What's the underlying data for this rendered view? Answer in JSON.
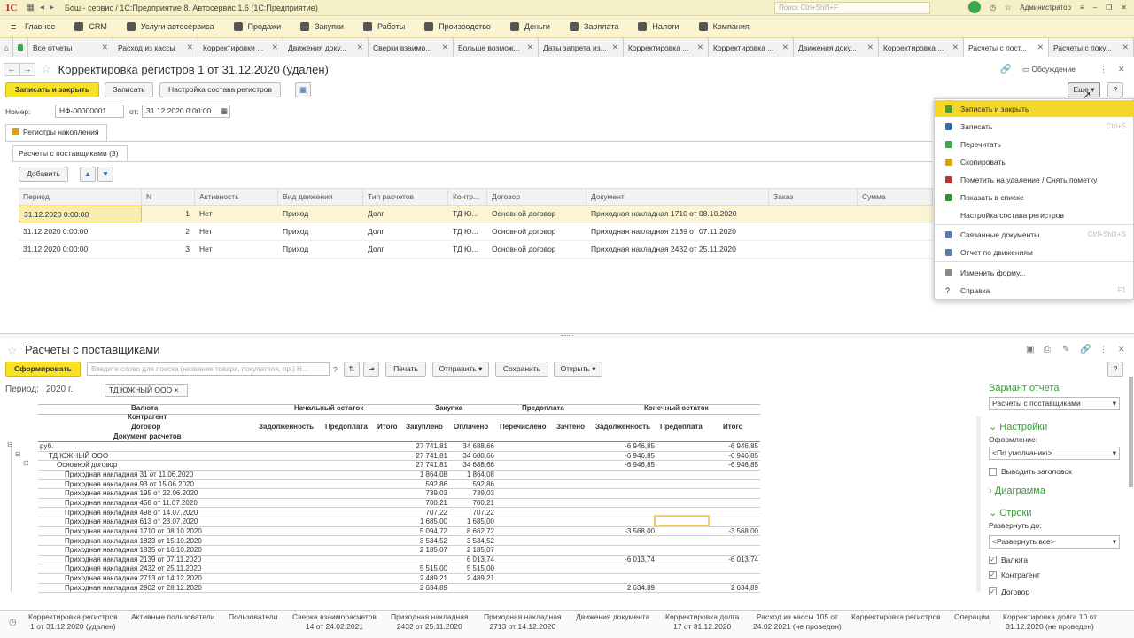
{
  "titlebar": {
    "logo": "1С",
    "title": "Бош - сервис / 1С:Предприятие 8. Автосервис 1.6  (1С:Предприятие)",
    "search_placeholder": "Поиск Ctrl+Shift+F",
    "user": "Администратор"
  },
  "menu": [
    {
      "label": "Главное"
    },
    {
      "label": "CRM"
    },
    {
      "label": "Услуги автосервиса"
    },
    {
      "label": "Продажи"
    },
    {
      "label": "Закупки"
    },
    {
      "label": "Работы"
    },
    {
      "label": "Производство"
    },
    {
      "label": "Деньги"
    },
    {
      "label": "Зарплата"
    },
    {
      "label": "Налоги"
    },
    {
      "label": "Компания"
    }
  ],
  "tabs": [
    {
      "label": "Все отчеты"
    },
    {
      "label": "Расход из кассы"
    },
    {
      "label": "Корректировки ..."
    },
    {
      "label": "Движения доку..."
    },
    {
      "label": "Сверки взаимо..."
    },
    {
      "label": "Больше возмож..."
    },
    {
      "label": "Даты запрета из..."
    },
    {
      "label": "Корректировка ..."
    },
    {
      "label": "Корректировка ..."
    },
    {
      "label": "Движения доку..."
    },
    {
      "label": "Корректировка ..."
    },
    {
      "label": "Расчеты с пост..."
    },
    {
      "label": "Расчеты с поку..."
    }
  ],
  "form": {
    "title": "Корректировка регистров 1 от 31.12.2020 (удален)",
    "discussion": "Обсуждение",
    "btn_save_close": "Записать и закрыть",
    "btn_save": "Записать",
    "btn_registers": "Настройка состава регистров",
    "btn_more": "Еще",
    "help": "?",
    "number_label": "Номер:",
    "number_value": "НФ-00000001",
    "date_label": "от:",
    "date_value": "31.12.2020  0:00:00",
    "group_tab": "Регистры накопления",
    "sub_tab": "Расчеты с поставщиками (3)",
    "btn_add": "Добавить"
  },
  "reg_table": {
    "headers": [
      "Период",
      "N",
      "Активность",
      "Вид движения",
      "Тип расчетов",
      "Контр...",
      "Договор",
      "Документ",
      "Заказ",
      "Сумма"
    ],
    "rows": [
      [
        "31.12.2020 0:00:00",
        "1",
        "Нет",
        "Приход",
        "Долг",
        "ТД Ю...",
        "Основной договор",
        "Приходная накладная 1710 от 08.10.2020",
        "",
        ""
      ],
      [
        "31.12.2020 0:00:00",
        "2",
        "Нет",
        "Приход",
        "Долг",
        "ТД Ю...",
        "Основной договор",
        "Приходная накладная 2139 от 07.11.2020",
        "",
        ""
      ],
      [
        "31.12.2020 0:00:00",
        "3",
        "Нет",
        "Приход",
        "Долг",
        "ТД Ю...",
        "Основной договор",
        "Приходная накладная 2432 от 25.11.2020",
        "",
        ""
      ]
    ]
  },
  "dropdown": [
    {
      "label": "Записать и закрыть",
      "shortcut": "",
      "icon": "save-close-icon",
      "color": "#4a9a3a"
    },
    {
      "label": "Записать",
      "shortcut": "Ctrl+S",
      "icon": "disk-icon",
      "color": "#3a6ab0"
    },
    {
      "label": "Перечитать",
      "shortcut": "",
      "icon": "refresh-icon",
      "color": "#3aa84b"
    },
    {
      "label": "Скопировать",
      "shortcut": "",
      "icon": "copy-icon",
      "color": "#d9a400"
    },
    {
      "label": "Пометить на удаление / Снять пометку",
      "shortcut": "",
      "icon": "delete-mark-icon",
      "color": "#c03030"
    },
    {
      "label": "Показать в списке",
      "shortcut": "",
      "icon": "list-icon",
      "color": "#3a8a3a"
    },
    {
      "label": "Настройка состава регистров",
      "shortcut": "",
      "icon": "",
      "color": "#fff"
    },
    {
      "label": "Связанные документы",
      "shortcut": "Ctrl+Shift+S",
      "icon": "linked-docs-icon",
      "color": "#5a7ab0"
    },
    {
      "label": "Отчет по движениям",
      "shortcut": "",
      "icon": "report-icon",
      "color": "#5a7ab0"
    },
    {
      "label": "Изменить форму...",
      "shortcut": "",
      "icon": "form-icon",
      "color": "#888"
    },
    {
      "label": "Справка",
      "shortcut": "F1",
      "icon": "help-icon",
      "color": "#333"
    }
  ],
  "report": {
    "title": "Расчеты с поставщиками",
    "btn_generate": "Сформировать",
    "search_placeholder": "Введите слово для поиска (название товара, покупателя, пр.) Н...",
    "help_q": "?",
    "btn_print": "Печать",
    "btn_send": "Отправить",
    "btn_save": "Сохранить",
    "btn_open": "Открыть",
    "period_label": "Период:",
    "period_value": "2020 г.",
    "filter_chip": "ТД ЮЖНЫЙ ООО ×",
    "col_groups": [
      "Валюта",
      "Начальный остаток",
      "Закупка",
      "Предоплата",
      "Конечный остаток"
    ],
    "row_dims": [
      "Контрагент",
      "Договор",
      "Документ расчетов"
    ],
    "subcols": [
      "Задолженность",
      "Предоплата",
      "Итого",
      "Закуплено",
      "Оплачено",
      "Перечислено",
      "Зачтено",
      "Задолженность",
      "Предоплата",
      "Итого"
    ],
    "rows": [
      {
        "name": "руб.",
        "level": 0,
        "zak": "27 741,81",
        "opl": "34 688,66",
        "kz": "-6 946,85",
        "ki": "-6 946,85"
      },
      {
        "name": "ТД ЮЖНЫЙ ООО",
        "level": 1,
        "zak": "27 741,81",
        "opl": "34 688,66",
        "kz": "-6 946,85",
        "ki": "-6 946,85"
      },
      {
        "name": "Основной договор",
        "level": 2,
        "zak": "27 741,81",
        "opl": "34 688,66",
        "kz": "-6 946,85",
        "ki": "-6 946,85"
      },
      {
        "name": "Приходная накладная 31 от 11.06.2020",
        "level": 3,
        "zak": "1 864,08",
        "opl": "1 864,08",
        "kz": "",
        "ki": ""
      },
      {
        "name": "Приходная накладная 93 от 15.06.2020",
        "level": 3,
        "zak": "592,86",
        "opl": "592,86",
        "kz": "",
        "ki": ""
      },
      {
        "name": "Приходная накладная 195 от 22.06.2020",
        "level": 3,
        "zak": "739,03",
        "opl": "739,03",
        "kz": "",
        "ki": ""
      },
      {
        "name": "Приходная накладная 458 от 11.07.2020",
        "level": 3,
        "zak": "700,21",
        "opl": "700,21",
        "kz": "",
        "ki": ""
      },
      {
        "name": "Приходная накладная 498 от 14.07.2020",
        "level": 3,
        "zak": "707,22",
        "opl": "707,22",
        "kz": "",
        "ki": ""
      },
      {
        "name": "Приходная накладная 613 от 23.07.2020",
        "level": 3,
        "zak": "1 685,00",
        "opl": "1 685,00",
        "kz": "",
        "ki": ""
      },
      {
        "name": "Приходная накладная 1710 от 08.10.2020",
        "level": 3,
        "zak": "5 094,72",
        "opl": "8 662,72",
        "kz": "-3 568,00",
        "ki": "-3 568,00"
      },
      {
        "name": "Приходная накладная 1823 от 15.10.2020",
        "level": 3,
        "zak": "3 534,52",
        "opl": "3 534,52",
        "kz": "",
        "ki": ""
      },
      {
        "name": "Приходная накладная 1835 от 16.10.2020",
        "level": 3,
        "zak": "2 185,07",
        "opl": "2 185,07",
        "kz": "",
        "ki": ""
      },
      {
        "name": "Приходная накладная 2139 от 07.11.2020",
        "level": 3,
        "zak": "",
        "opl": "6 013,74",
        "kz": "-6 013,74",
        "ki": "-6 013,74"
      },
      {
        "name": "Приходная накладная 2432 от 25.11.2020",
        "level": 3,
        "zak": "5 515,00",
        "opl": "5 515,00",
        "kz": "",
        "ki": ""
      },
      {
        "name": "Приходная накладная 2713 от 14.12.2020",
        "level": 3,
        "zak": "2 489,21",
        "opl": "2 489,21",
        "kz": "",
        "ki": ""
      },
      {
        "name": "Приходная накладная 2902 от 28.12.2020",
        "level": 3,
        "zak": "2 634,89",
        "opl": "",
        "kz": "2 634,89",
        "ki": "2 634,89"
      }
    ]
  },
  "right_panel": {
    "variant_header": "Вариант отчета",
    "variant_value": "Расчеты с поставщиками",
    "settings_header": "Настройки",
    "design_label": "Оформление:",
    "design_value": "<По умолчанию>",
    "show_title": "Выводить заголовок",
    "diagram_header": "Диаграмма",
    "rows_header": "Строки",
    "expand_label": "Развернуть до:",
    "expand_value": "<Развернуть все>",
    "check_currency": "Валюта",
    "check_counterparty": "Контрагент",
    "check_contract": "Договор"
  },
  "statusbar": [
    {
      "l1": "Корректировка регистров",
      "l2": "1 от 31.12.2020 (удален)"
    },
    {
      "l1": "Активные пользователи",
      "l2": ""
    },
    {
      "l1": "Пользователи",
      "l2": ""
    },
    {
      "l1": "Сверка взаиморасчетов",
      "l2": "14 от 24.02.2021"
    },
    {
      "l1": "Приходная накладная",
      "l2": "2432 от 25.11.2020"
    },
    {
      "l1": "Приходная накладная",
      "l2": "2713 от 14.12.2020"
    },
    {
      "l1": "Движения документа",
      "l2": ""
    },
    {
      "l1": "Корректировка долга",
      "l2": "17 от 31.12.2020"
    },
    {
      "l1": "Расход из кассы 105 от",
      "l2": "24.02.2021 (не проведен)"
    },
    {
      "l1": "Корректировка регистров",
      "l2": ""
    },
    {
      "l1": "Операции",
      "l2": ""
    },
    {
      "l1": "Корректировка долга 10 от",
      "l2": "31.12.2020 (не проведен)"
    }
  ]
}
